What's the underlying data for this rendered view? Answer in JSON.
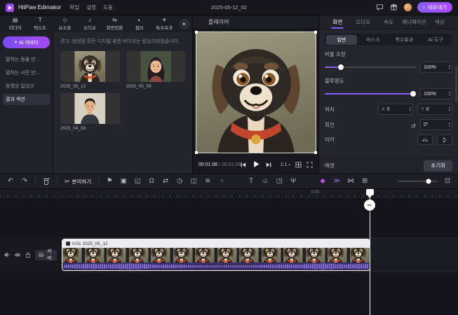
{
  "titlebar": {
    "app_name": "HitPaw Edimakor",
    "menus": [
      {
        "label": "파일"
      },
      {
        "label": "설정"
      },
      {
        "label": "도움"
      }
    ],
    "project_title": "2025-05-12_02",
    "export_label": "내보내기"
  },
  "asset_panel": {
    "tabs": [
      {
        "label": "미디어",
        "glyph": "▤"
      },
      {
        "label": "텍스트",
        "glyph": "T"
      },
      {
        "label": "요소들",
        "glyph": "◇"
      },
      {
        "label": "오디오",
        "glyph": "♪"
      },
      {
        "label": "화면전환",
        "glyph": "⇆"
      },
      {
        "label": "필터",
        "glyph": "◐"
      },
      {
        "label": "특수효과",
        "glyph": "✶"
      }
    ],
    "more_glyph": "▸",
    "sidebar": [
      {
        "label": "AI 아바타"
      },
      {
        "label": "말하는 동물 만..."
      },
      {
        "label": "말하는 사진 만..."
      },
      {
        "label": "동영상 립싱크"
      },
      {
        "label": "결과 섹션"
      }
    ],
    "warning": "경고: 생성된 모든 디지털 휴먼 비디오는 립싱크되었습니다.",
    "items": [
      {
        "label": "2025_05_12"
      },
      {
        "label": "2025_05_09"
      },
      {
        "label": "2025_04_08"
      }
    ]
  },
  "player": {
    "title": "플레이어",
    "current_time": "00:01:06",
    "separator": "/",
    "duration": "00:01:06",
    "ratio_label": "1:1"
  },
  "inspector": {
    "tabs": [
      {
        "label": "화면"
      },
      {
        "label": "오디오"
      },
      {
        "label": "속도"
      },
      {
        "label": "애니메이션"
      },
      {
        "label": "색상"
      }
    ],
    "subtabs": [
      {
        "label": "일반"
      },
      {
        "label": "마스크"
      },
      {
        "label": "특수효과"
      },
      {
        "label": "AI 도구"
      }
    ],
    "rows": {
      "scale": {
        "label": "비율 조정",
        "value": "100%"
      },
      "opacity": {
        "label": "불투명도",
        "value": "100%"
      },
      "position": {
        "label": "위치",
        "x_label": "X",
        "x_value": "0",
        "y_label": "Y",
        "y_value": "0"
      },
      "rotate": {
        "label": "회전",
        "value": "0°"
      },
      "mirror": {
        "label": "미러"
      },
      "background": {
        "label": "배경"
      }
    },
    "reset_label": "초기화"
  },
  "toolbar": {
    "split_label": "분리하기",
    "icons": [
      {
        "name": "undo-icon",
        "glyph": "↶"
      },
      {
        "name": "redo-icon",
        "glyph": "↷"
      },
      {
        "name": "marker-icon",
        "glyph": "⚑"
      },
      {
        "name": "mask-icon",
        "glyph": "▣"
      },
      {
        "name": "crop-icon",
        "glyph": "◱"
      },
      {
        "name": "magnet-icon",
        "glyph": "Ω"
      },
      {
        "name": "flip-icon",
        "glyph": "⇄"
      },
      {
        "name": "duration-icon",
        "glyph": "◷"
      },
      {
        "name": "mirror-icon",
        "glyph": "◫"
      },
      {
        "name": "denoise-icon",
        "glyph": "≋"
      },
      {
        "name": "position-icon",
        "glyph": "⌖"
      },
      {
        "name": "add-text-icon",
        "glyph": "T"
      },
      {
        "name": "sticker-icon",
        "glyph": "☺"
      },
      {
        "name": "pip-icon",
        "glyph": "◳"
      },
      {
        "name": "voiceover-icon",
        "glyph": "Ψ"
      },
      {
        "name": "ai-effect-icon",
        "glyph": "◆"
      },
      {
        "name": "speed-ramp-icon",
        "glyph": "≫"
      },
      {
        "name": "link-icon",
        "glyph": "⋈"
      },
      {
        "name": "grid-icon",
        "glyph": "⊞"
      },
      {
        "name": "fit-timeline-icon",
        "glyph": "⊡"
      }
    ]
  },
  "timeline": {
    "ruler_label": "0:01",
    "cover_label": "커버",
    "clip_title": "0:01  2025_05_12",
    "thumb_count": 14
  },
  "colors": {
    "accent": "#8b5cf6",
    "magenta": "#c24bf0",
    "export_gradient_start": "#7a3bf0",
    "export_gradient_end": "#a84bf5"
  }
}
